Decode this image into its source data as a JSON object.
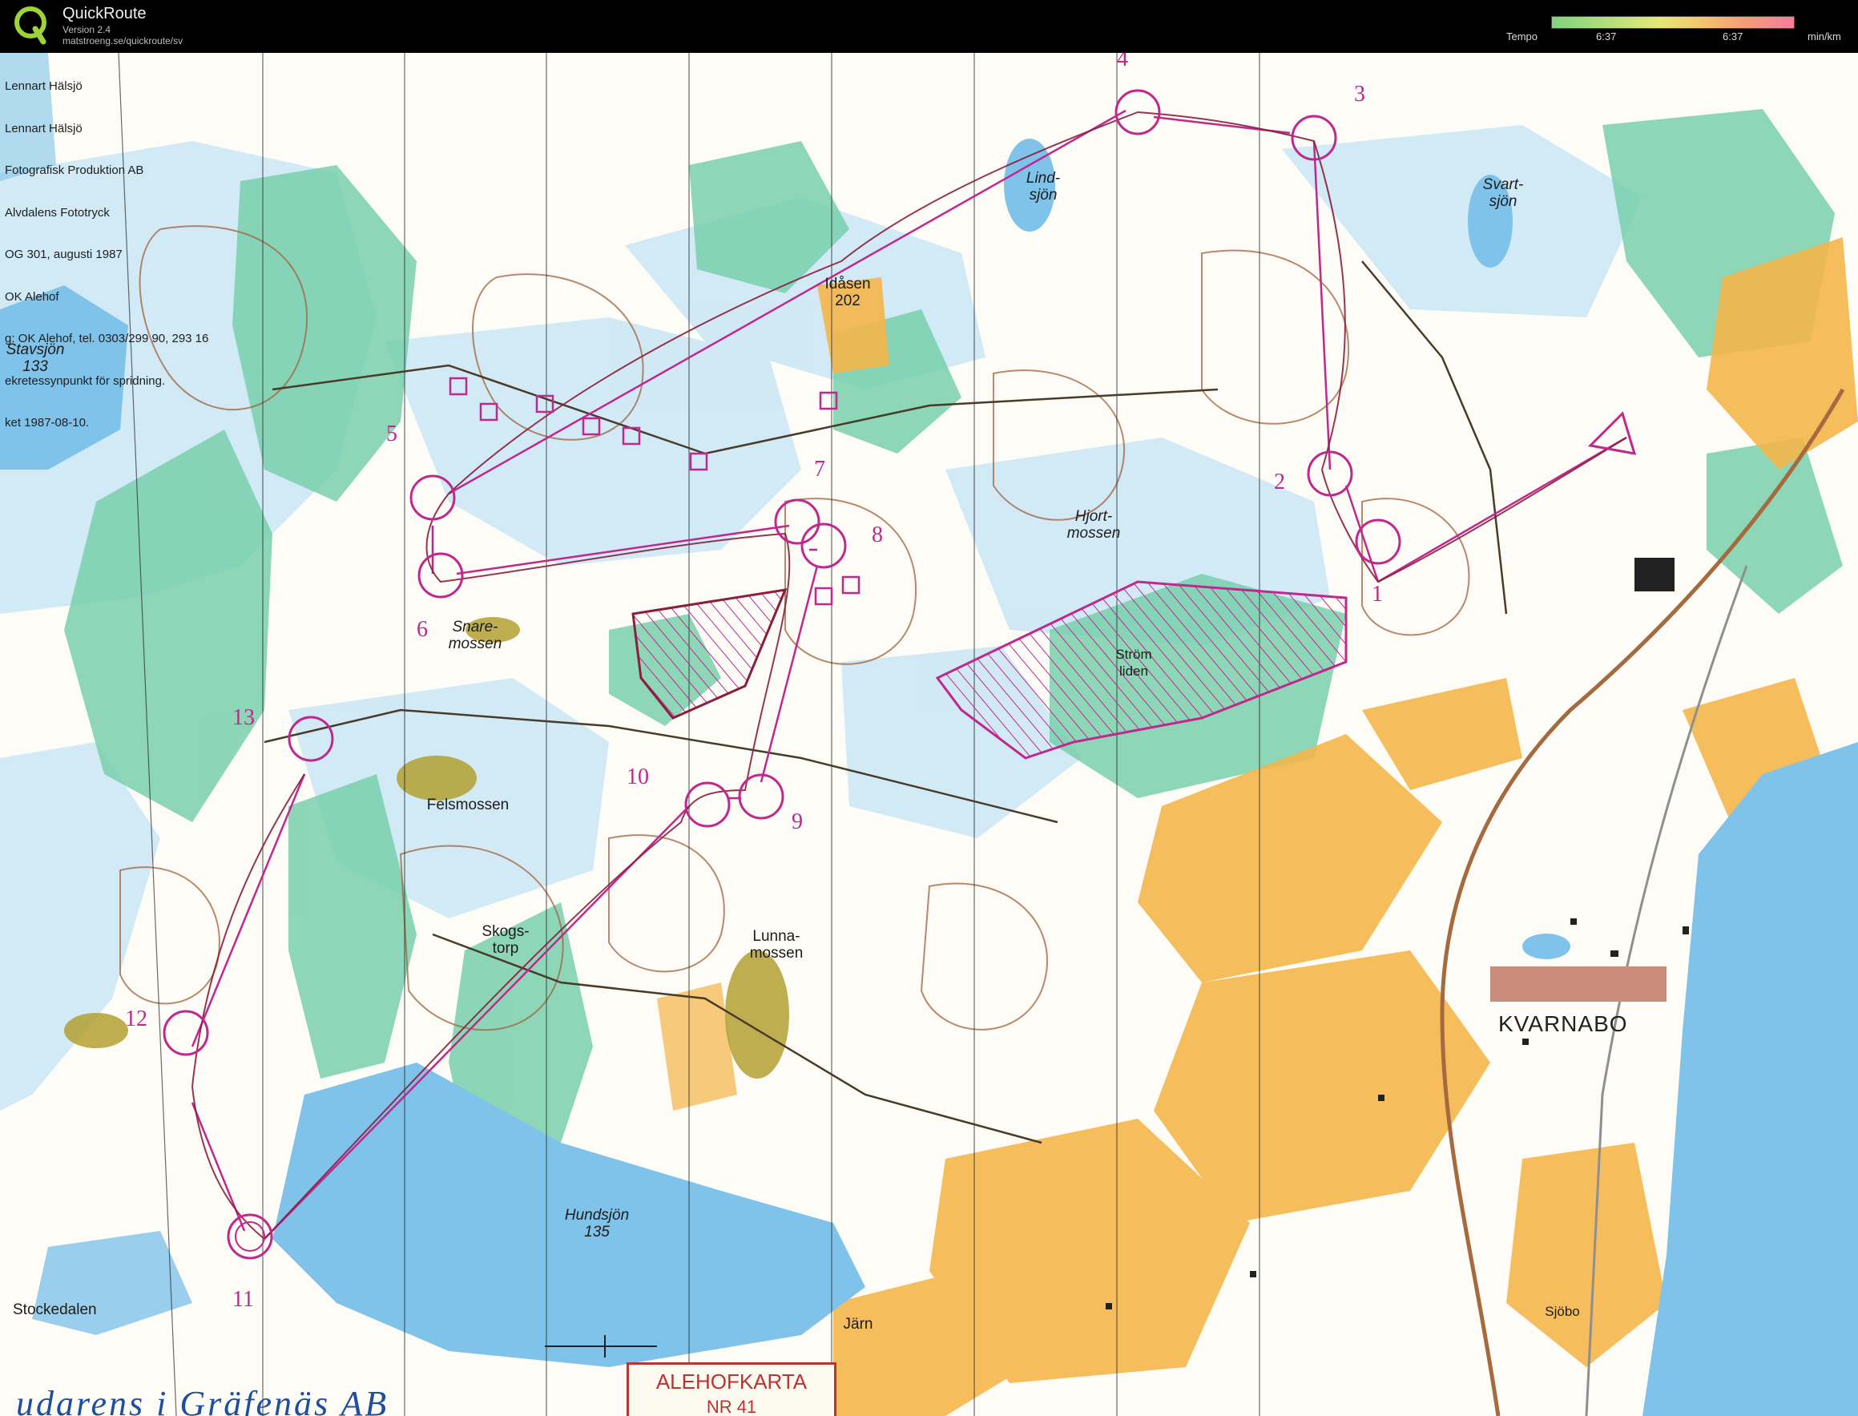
{
  "app": {
    "name": "QuickRoute",
    "version": "Version 2.4",
    "url": "matstroeng.se/quickroute/sv"
  },
  "tempo_legend": {
    "label": "Tempo",
    "value_left": "6:37",
    "value_right": "6:37",
    "unit": "min/km",
    "colors": [
      "#7fd37f",
      "#b8e07c",
      "#e6e77a",
      "#f3c96f",
      "#f49c78",
      "#f17fa0"
    ]
  },
  "map": {
    "credits": [
      "Lennart Hälsjö",
      "Lennart Hälsjö",
      "Fotografisk Produktion AB",
      "Alvdalens Fototryck",
      "OG 301, augusti 1987",
      "OK Alehof",
      "g: OK Alehof, tel. 0303/299 90, 293 16",
      "ekretessynpunkt för spridning.",
      "ket 1987-08-10."
    ],
    "places": {
      "stavsjon": [
        "Stavsjön",
        "133"
      ],
      "lindsjon": [
        "Lind-",
        "sjön"
      ],
      "svartsjon": [
        "Svart-",
        "sjön"
      ],
      "idason": [
        "Idåsen",
        "202"
      ],
      "hjortmossen": [
        "Hjort-",
        "mossen"
      ],
      "snaremossen": [
        "Snare-",
        "mossen"
      ],
      "stromliden": [
        "Ström",
        "liden"
      ],
      "felsmossen": "Felsmossen",
      "skogstorp": [
        "Skogs-",
        "torp"
      ],
      "lunnamossen": [
        "Lunna-",
        "mossen"
      ],
      "hundsjon": [
        "Hundsjön",
        "135"
      ],
      "stockedalen": "Stockedalen",
      "jarn": "Järn",
      "sjobo": "Sjöbo",
      "kvarnabo": "KVARNABO"
    },
    "map_title": "ALEHOFKARTA",
    "map_subtitle": "NR 41",
    "bottom_script": "udarens i Gräfenäs AB",
    "controls": [
      "1",
      "2",
      "3",
      "4",
      "5",
      "6",
      "7",
      "8",
      "9",
      "10",
      "11",
      "12",
      "13"
    ],
    "colors": {
      "water": "#7fc3ea",
      "marsh": "#bfe3f3",
      "green": "#5cc7a0",
      "yellow": "#f2b63a",
      "contour": "#a0633b",
      "course": "#c0288e",
      "route": "#8a1f3d"
    }
  }
}
